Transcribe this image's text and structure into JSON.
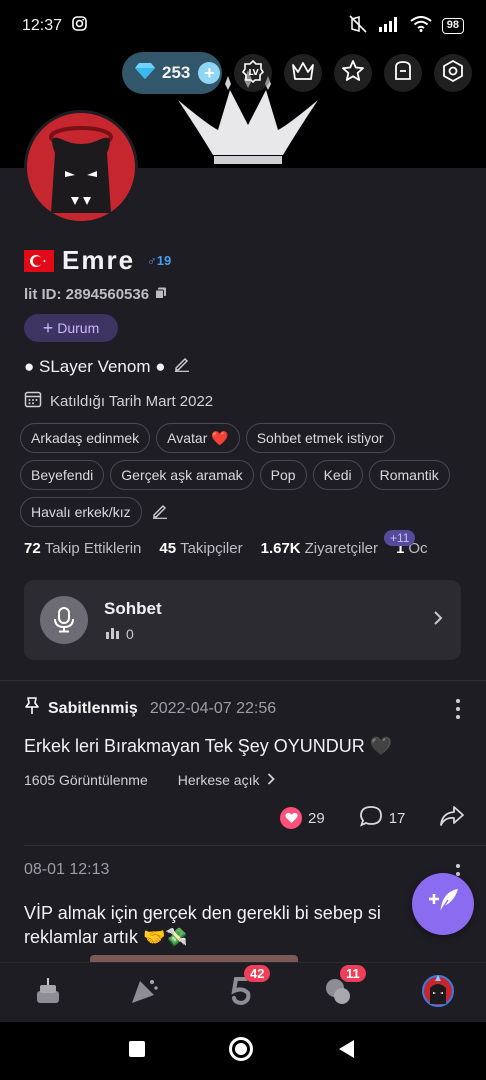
{
  "status_bar": {
    "time": "12:37",
    "battery": "98"
  },
  "top_bar": {
    "diamonds": "253"
  },
  "profile": {
    "name": "Emre",
    "gender_age": "♂19",
    "lit_id": "lit ID: 2894560536",
    "durum_label": "Durum",
    "bio": "● SLayer Venom ●",
    "joined": "Katıldığı Tarih Mart 2022",
    "tags": [
      "Arkadaş edinmek",
      "Avatar ❤️",
      "Sohbet etmek istiyor",
      "Beyefendi",
      "Gerçek aşk aramak",
      "Pop",
      "Kedi",
      "Romantik",
      "Havalı erkek/kız"
    ]
  },
  "stats": {
    "following_count": "72",
    "following_label": "Takip Ettiklerin",
    "followers_count": "45",
    "followers_label": "Takipçiler",
    "visitors_count": "1.67K",
    "visitors_label": "Ziyaretçiler",
    "visitors_new": "+11",
    "fourth_count": "1",
    "fourth_label": "Oc"
  },
  "sohbet_card": {
    "title": "Sohbet",
    "count": "0"
  },
  "post1": {
    "pinned_label": "Sabitlenmiş",
    "date": "2022-04-07 22:56",
    "text": "Erkek leri Bırakmayan Tek Şey OYUNDUR 🖤",
    "views": "1605 Görüntülenme",
    "visibility": "Herkese açık",
    "likes": "29",
    "comments": "17"
  },
  "post2": {
    "date": "08-01 12:13",
    "text_line1": "VİP almak için gerçek den gerekli bi sebep si",
    "text_line2": "reklamlar artık 🤝💸"
  },
  "bottom_tabs": {
    "badge_tab3": "42",
    "badge_tab4": "11"
  },
  "colors": {
    "accent": "#8b6cf0",
    "background": "#1f1d24",
    "like": "#ff4f7b",
    "badge": "#ef3e5a"
  }
}
